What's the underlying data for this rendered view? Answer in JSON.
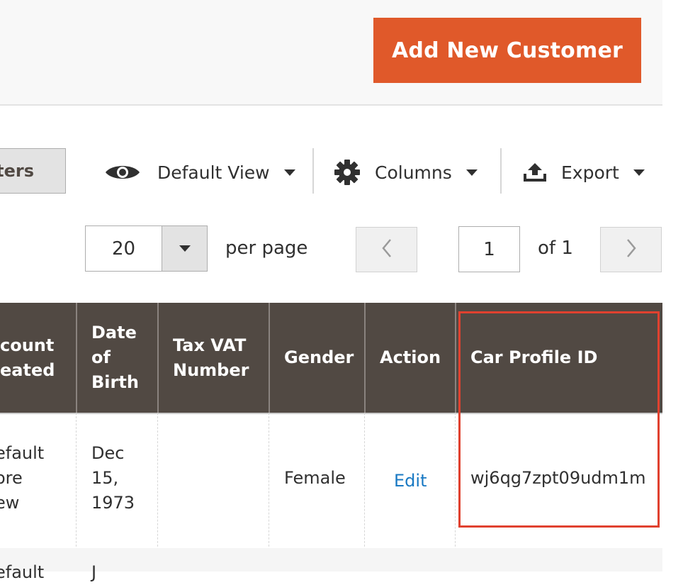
{
  "header": {
    "add_button": "Add New Customer"
  },
  "toolbar": {
    "filters_label": "ters",
    "default_view": "Default View",
    "columns": "Columns",
    "export": "Export"
  },
  "pagination": {
    "per_page_value": "20",
    "per_page_label": "per page",
    "current_page": "1",
    "of_total": "of 1"
  },
  "table": {
    "headers": [
      "count\neated",
      "Date\nof\nBirth",
      "Tax VAT\nNumber",
      "Gender",
      "Action",
      "Car Profile ID"
    ],
    "rows": [
      {
        "account_created": "efault\nore\new",
        "dob": "Dec\n15,\n1973",
        "tax_vat": "",
        "gender": "Female",
        "action": "Edit",
        "car_profile_id": "wj6qg7zpt09udm1m"
      },
      {
        "account_created": "efault",
        "dob": "J"
      }
    ]
  },
  "colors": {
    "accent": "#e0592a",
    "header_bg": "#514943",
    "link": "#1979c3",
    "highlight": "#e0412f"
  }
}
